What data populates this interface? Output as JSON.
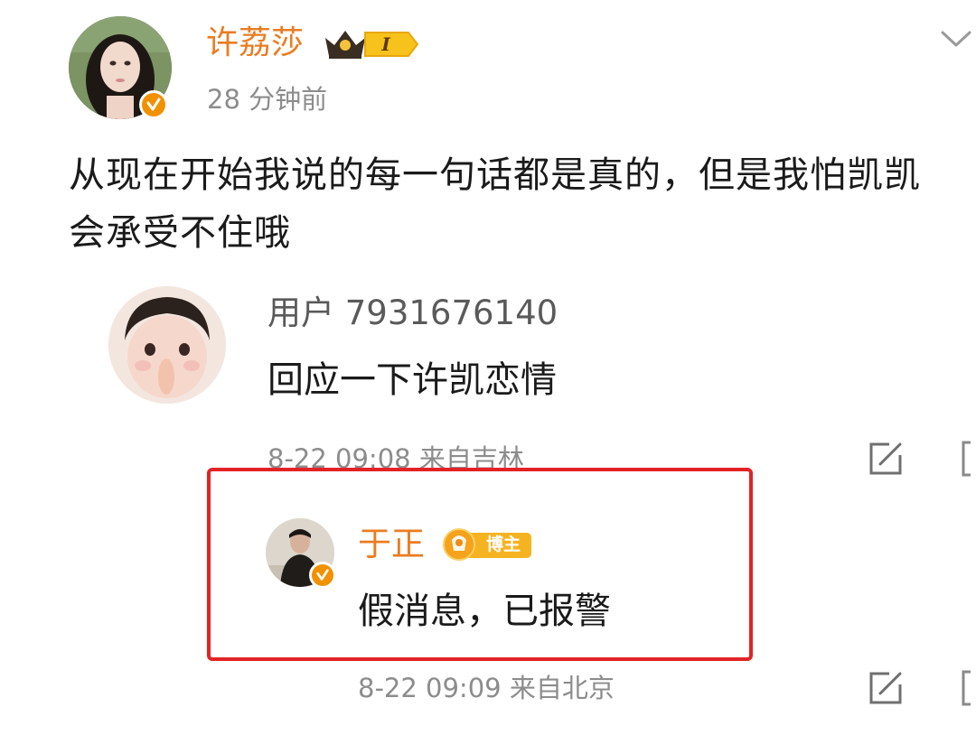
{
  "post": {
    "author_name": "许荔莎",
    "level_badge": "I",
    "time": "28 分钟前",
    "text": "从现在开始我说的每一句话都是真的，但是我怕凯凯会承受不住哦"
  },
  "comments": [
    {
      "username": "用户 7931676140",
      "text": "回应一下许凯恋情",
      "meta": "8-22 09:08  来自吉林"
    },
    {
      "username": "于正",
      "badge_label": "博主",
      "text": "假消息，已报警",
      "meta": "8-22 09:09  来自北京"
    }
  ],
  "colors": {
    "name_orange": "#ea7c22",
    "verified_orange": "#f29100",
    "gray_text": "#8c8c8c",
    "highlight_red": "#e32226"
  },
  "icons": [
    "verified-badge-icon",
    "crown-icon",
    "chevron-down-icon",
    "edit-icon",
    "blogger-badge-icon"
  ]
}
